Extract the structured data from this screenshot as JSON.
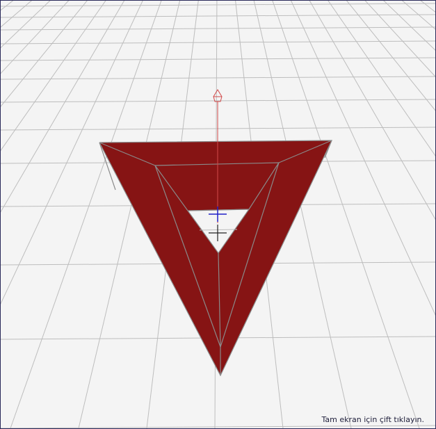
{
  "viewport": {
    "hint_text": "Tam ekran için çift tıklayın."
  },
  "colors": {
    "background": "#f4f4f4",
    "grid_line": "#bdbdbd",
    "model_fill": "#861414",
    "model_edge": "#8a8a8a",
    "gizmo_y_axis": "#d24a4a",
    "gizmo_center": "#2020c8",
    "pivot_cross": "#202020",
    "border": "#2a2a5a"
  },
  "scene": {
    "grid": "perspective-floor-grid",
    "model": "triangular-frame-3d-model",
    "gizmo": "translate-y-axis-gizmo"
  }
}
